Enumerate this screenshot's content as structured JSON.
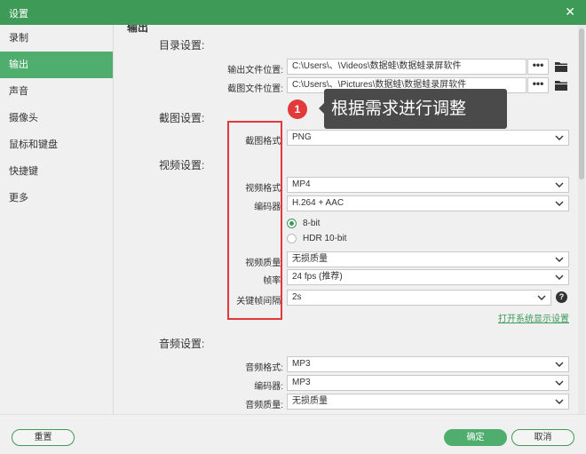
{
  "window": {
    "title": "设置"
  },
  "sidebar": {
    "items": [
      {
        "label": "录制"
      },
      {
        "label": "输出"
      },
      {
        "label": "声音"
      },
      {
        "label": "摄像头"
      },
      {
        "label": "鼠标和键盘"
      },
      {
        "label": "快捷键"
      },
      {
        "label": "更多"
      }
    ],
    "active_index": 1
  },
  "main": {
    "section_cut_title": "输出",
    "directory": {
      "title": "目录设置:",
      "output_label": "输出文件位置:",
      "output_value": "C:\\Users\\、\\Videos\\数据蛙\\数据蛙录屏软件",
      "screenshot_label": "截图文件位置:",
      "screenshot_value": "C:\\Users\\、\\Pictures\\数据蛙\\数据蛙录屏软件",
      "browse_label": "•••"
    },
    "screenshot": {
      "title": "截图设置:",
      "format_label": "截图格式:",
      "format_value": "PNG"
    },
    "video": {
      "title": "视频设置:",
      "format_label": "视频格式:",
      "format_value": "MP4",
      "encoder_label": "编码器:",
      "encoder_value": "H.264 + AAC",
      "bit_8_label": "8-bit",
      "bit_hdr_label": "HDR 10-bit",
      "bit_selected": "8-bit",
      "quality_label": "视频质量:",
      "quality_value": "无损质量",
      "fps_label": "帧率:",
      "fps_value": "24 fps (推荐)",
      "keyframe_label": "关键帧间隔:",
      "keyframe_value": "2s",
      "help_label": "?",
      "display_settings_link": "打开系统显示设置"
    },
    "audio": {
      "title": "音频设置:",
      "format_label": "音频格式:",
      "format_value": "MP3",
      "encoder_label": "编码器:",
      "encoder_value": "MP3",
      "quality_label": "音频质量:",
      "quality_value": "无损质量"
    }
  },
  "annotation": {
    "step_number": "1",
    "text": "根据需求进行调整",
    "box_color": "#e23a3a"
  },
  "footer": {
    "reset_label": "重置",
    "ok_label": "确定",
    "cancel_label": "取消"
  },
  "colors": {
    "accent": "#3d9a57",
    "active_nav": "#4fae6e"
  }
}
